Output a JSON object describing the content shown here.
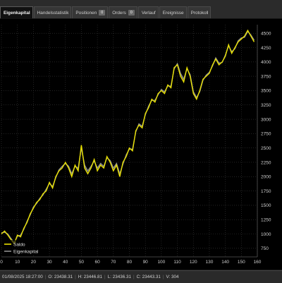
{
  "tabs": [
    {
      "label": "Eigenkapital",
      "active": true
    },
    {
      "label": "Handelsstatistik"
    },
    {
      "label": "Positionen",
      "badge": "0"
    },
    {
      "label": "Orders",
      "badge": "0"
    },
    {
      "label": "Verlauf"
    },
    {
      "label": "Ereignisse"
    },
    {
      "label": "Protokoll"
    }
  ],
  "status": {
    "datetime": "01/08/2025 18:27:00",
    "open": "O: 23438.31",
    "high": "H: 23446.81",
    "low": "L: 23436.31",
    "close": "C: 23443.31",
    "volume": "V: 304"
  },
  "colors": {
    "saldo": "#e8e000",
    "eigenkapital": "#8f8f8f",
    "grid": "#3a3a3a"
  },
  "chart_data": {
    "type": "line",
    "xlim": [
      0,
      160
    ],
    "ylim": [
      600,
      4650
    ],
    "xticks": [
      0,
      10,
      20,
      30,
      40,
      50,
      60,
      70,
      80,
      90,
      100,
      110,
      120,
      130,
      140,
      150,
      160
    ],
    "yticks": [
      750,
      1000,
      1250,
      1500,
      1750,
      2000,
      2250,
      2500,
      2750,
      3000,
      3250,
      3500,
      3750,
      4000,
      4250,
      4500
    ],
    "legend": {
      "position": "bottom-left",
      "entries": [
        "Saldo",
        "Eigenkapital"
      ]
    },
    "series": [
      {
        "name": "Saldo",
        "x": [
          0,
          2,
          4,
          6,
          8,
          10,
          12,
          14,
          16,
          18,
          20,
          22,
          24,
          26,
          28,
          30,
          32,
          34,
          36,
          38,
          40,
          42,
          44,
          46,
          48,
          50,
          52,
          54,
          56,
          58,
          60,
          62,
          64,
          66,
          68,
          70,
          72,
          74,
          76,
          78,
          80,
          82,
          84,
          86,
          88,
          90,
          92,
          94,
          96,
          98,
          100,
          102,
          104,
          106,
          108,
          110,
          112,
          114,
          116,
          118,
          120,
          122,
          124,
          126,
          128,
          130,
          132,
          134,
          136,
          138,
          140,
          142,
          144,
          146,
          148,
          150,
          152,
          154,
          156,
          158
        ],
        "values": [
          1000,
          1050,
          980,
          900,
          830,
          980,
          950,
          1100,
          1200,
          1350,
          1450,
          1550,
          1600,
          1700,
          1750,
          1900,
          1800,
          2000,
          2100,
          2150,
          2250,
          2150,
          2000,
          2200,
          2100,
          2550,
          2150,
          2050,
          2150,
          2300,
          2100,
          2200,
          2150,
          2350,
          2250,
          2100,
          2200,
          2000,
          2250,
          2350,
          2500,
          2450,
          2800,
          2900,
          2850,
          3100,
          3200,
          3350,
          3300,
          3450,
          3500,
          3450,
          3600,
          3550,
          3900,
          3950,
          3750,
          3650,
          3900,
          3750,
          3450,
          3350,
          3500,
          3700,
          3750,
          3800,
          3950,
          4050,
          3950,
          4000,
          4100,
          4300,
          4150,
          4250,
          4350,
          4400,
          4450,
          4550,
          4450,
          4350
        ]
      },
      {
        "name": "Eigenkapital",
        "x": [
          0,
          2,
          4,
          6,
          8,
          10,
          12,
          14,
          16,
          18,
          20,
          22,
          24,
          26,
          28,
          30,
          32,
          34,
          36,
          38,
          40,
          42,
          44,
          46,
          48,
          50,
          52,
          54,
          56,
          58,
          60,
          62,
          64,
          66,
          68,
          70,
          72,
          74,
          76,
          78,
          80,
          82,
          84,
          86,
          88,
          90,
          92,
          94,
          96,
          98,
          100,
          102,
          104,
          106,
          108,
          110,
          112,
          114,
          116,
          118,
          120,
          122,
          124,
          126,
          128,
          130,
          132,
          134,
          136,
          138,
          140,
          142,
          144,
          146,
          148,
          150,
          152,
          154,
          156,
          158
        ],
        "values": [
          1020,
          1030,
          1000,
          920,
          850,
          960,
          980,
          1080,
          1220,
          1330,
          1470,
          1530,
          1620,
          1680,
          1780,
          1880,
          1830,
          1980,
          2120,
          2180,
          2230,
          2180,
          2050,
          2180,
          2150,
          2500,
          2200,
          2100,
          2180,
          2270,
          2150,
          2230,
          2180,
          2330,
          2280,
          2150,
          2230,
          2050,
          2220,
          2380,
          2480,
          2480,
          2780,
          2920,
          2880,
          3080,
          3230,
          3330,
          3330,
          3430,
          3520,
          3480,
          3580,
          3580,
          3880,
          3970,
          3800,
          3700,
          3880,
          3780,
          3480,
          3380,
          3480,
          3680,
          3770,
          3820,
          3930,
          4070,
          3980,
          3990,
          4120,
          4280,
          4180,
          4230,
          4370,
          4420,
          4430,
          4530,
          4470,
          4380
        ]
      }
    ]
  }
}
